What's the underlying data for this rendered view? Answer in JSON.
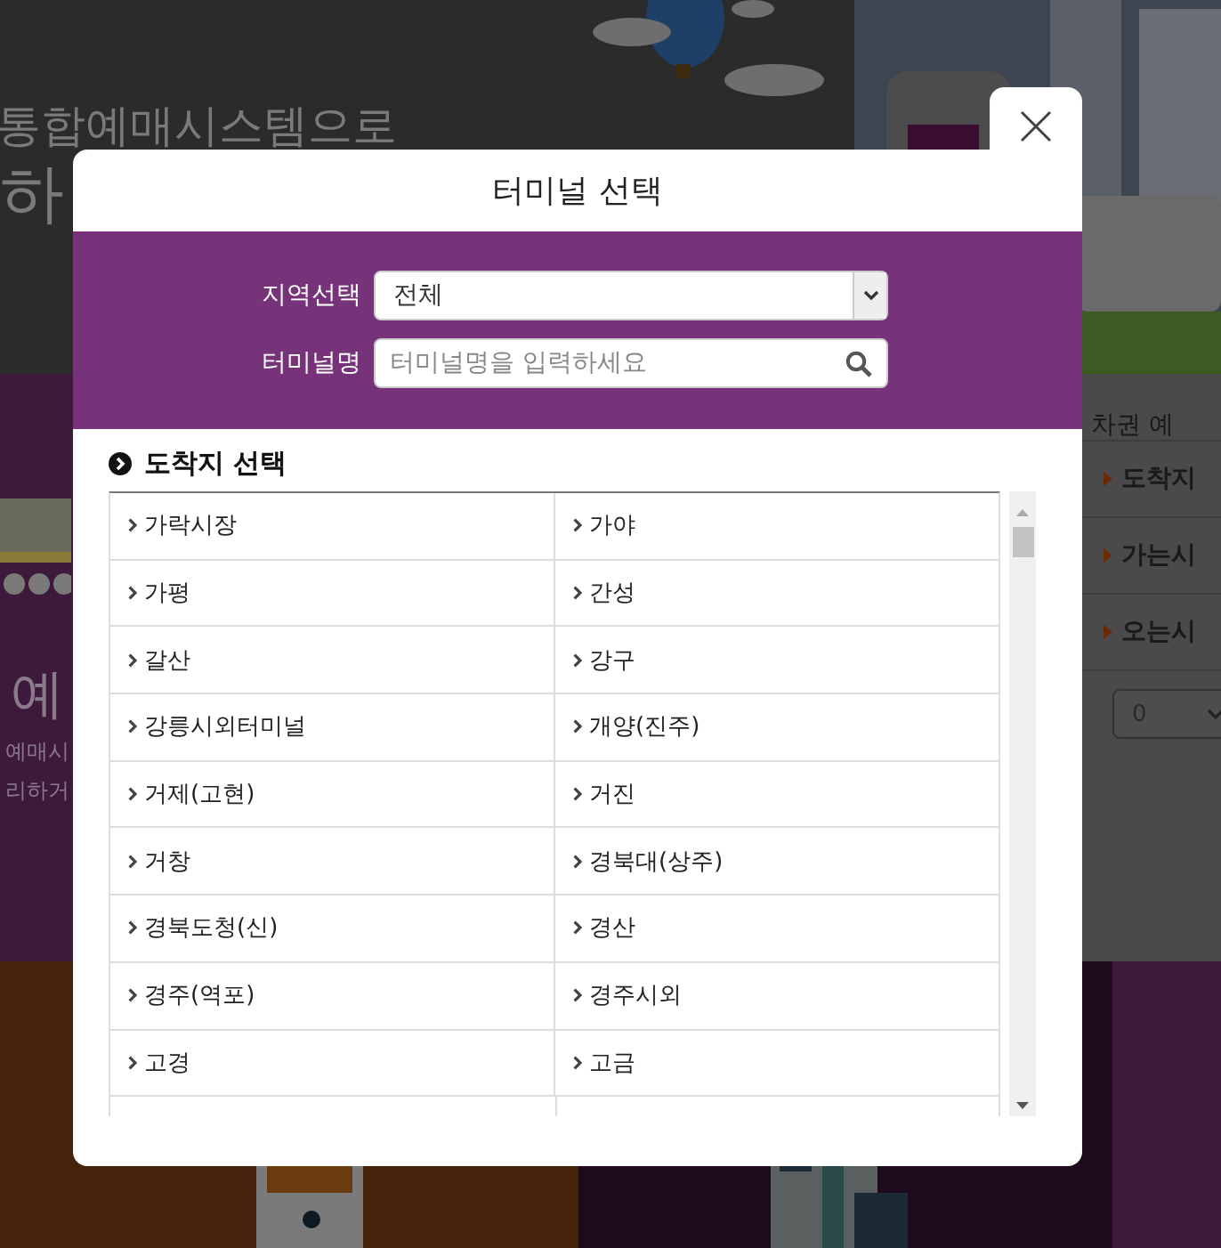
{
  "background": {
    "headline": "통합예매시스템으로",
    "headline_2": "하",
    "side_title": "예",
    "side_text": [
      "예매시",
      "리하거"
    ],
    "tab": "차권 예",
    "menu": [
      {
        "label": "도착지"
      },
      {
        "label": "가는시"
      },
      {
        "label": "오는시"
      }
    ],
    "count_select": "0"
  },
  "dialog": {
    "title": "터미널 선택",
    "region": {
      "label": "지역선택",
      "value": "전체"
    },
    "terminal": {
      "label": "터미널명",
      "placeholder": "터미널명을 입력하세요"
    },
    "section_title": "도착지 선택",
    "terminals": [
      "가락시장",
      "가야",
      "가평",
      "간성",
      "갈산",
      "강구",
      "강릉시외터미널",
      "개양(진주)",
      "거제(고현)",
      "거진",
      "거창",
      "경북대(상주)",
      "경북도청(신)",
      "경산",
      "경주(역포)",
      "경주시외",
      "고경",
      "고금"
    ]
  }
}
